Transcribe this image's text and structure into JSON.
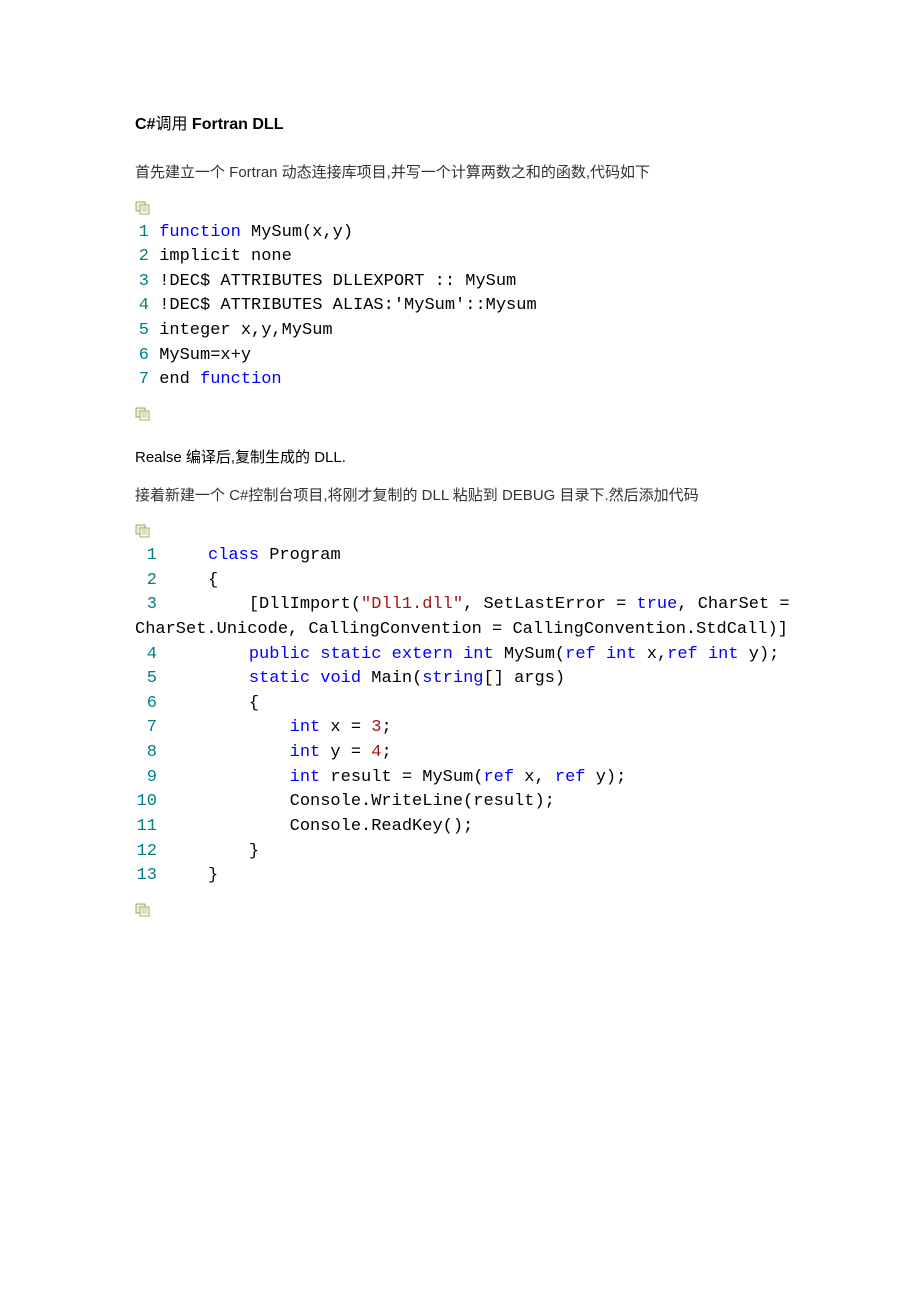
{
  "title_prefix": "C#",
  "title_cn": "调用",
  "title_bold": " Fortran DLL",
  "para1": "首先建立一个 Fortran 动态连接库项目,并写一个计算两数之和的函数,代码如下",
  "fortran_code": {
    "lines": [
      {
        "n": "1",
        "tokens": [
          {
            "t": " ",
            "c": "plain"
          },
          {
            "t": "function",
            "c": "kw-blue"
          },
          {
            "t": " MySum(x,y)",
            "c": "plain"
          }
        ]
      },
      {
        "n": "2",
        "tokens": [
          {
            "t": " implicit none",
            "c": "plain"
          }
        ]
      },
      {
        "n": "3",
        "tokens": [
          {
            "t": " !DEC$ ATTRIBUTES DLLEXPORT :: MySum",
            "c": "plain"
          }
        ]
      },
      {
        "n": "4",
        "tokens": [
          {
            "t": " !DEC$ ATTRIBUTES ALIAS:'MySum'::Mysum",
            "c": "plain"
          }
        ]
      },
      {
        "n": "5",
        "tokens": [
          {
            "t": " integer x,y,MySum",
            "c": "plain"
          }
        ]
      },
      {
        "n": "6",
        "tokens": [
          {
            "t": " MySum=x+y",
            "c": "plain"
          }
        ]
      },
      {
        "n": "7",
        "tokens": [
          {
            "t": " end ",
            "c": "plain"
          },
          {
            "t": "function",
            "c": "kw-blue"
          }
        ]
      }
    ]
  },
  "para2": "Realse 编译后,复制生成的 DLL.",
  "para3": "接着新建一个 C#控制台项目,将刚才复制的 DLL 粘贴到 DEBUG 目录下.然后添加代码",
  "csharp_code": {
    "lines": [
      {
        "n": " 1",
        "tokens": [
          {
            "t": "     ",
            "c": "plain"
          },
          {
            "t": "class",
            "c": "kw-blue"
          },
          {
            "t": " Program",
            "c": "plain"
          }
        ]
      },
      {
        "n": " 2",
        "tokens": [
          {
            "t": "     {",
            "c": "plain"
          }
        ]
      },
      {
        "n": " 3",
        "tokens": [
          {
            "t": "         [DllImport(",
            "c": "plain"
          },
          {
            "t": "\"Dll1.dll\"",
            "c": "str-red"
          },
          {
            "t": ", SetLastError = ",
            "c": "plain"
          },
          {
            "t": "true",
            "c": "kw-blue"
          },
          {
            "t": ", CharSet = ",
            "c": "plain"
          }
        ]
      },
      {
        "n": "",
        "wrap": true,
        "tokens": [
          {
            "t": "CharSet.Unicode, CallingConvention = CallingConvention.StdCall)]",
            "c": "plain"
          }
        ]
      },
      {
        "n": " 4",
        "tokens": [
          {
            "t": "         ",
            "c": "plain"
          },
          {
            "t": "public",
            "c": "kw-blue"
          },
          {
            "t": " ",
            "c": "plain"
          },
          {
            "t": "static",
            "c": "kw-blue"
          },
          {
            "t": " ",
            "c": "plain"
          },
          {
            "t": "extern",
            "c": "kw-blue"
          },
          {
            "t": " ",
            "c": "plain"
          },
          {
            "t": "int",
            "c": "kw-blue"
          },
          {
            "t": " MySum(",
            "c": "plain"
          },
          {
            "t": "ref",
            "c": "kw-blue"
          },
          {
            "t": " ",
            "c": "plain"
          },
          {
            "t": "int",
            "c": "kw-blue"
          },
          {
            "t": " x,",
            "c": "plain"
          },
          {
            "t": "ref",
            "c": "kw-blue"
          },
          {
            "t": " ",
            "c": "plain"
          },
          {
            "t": "int",
            "c": "kw-blue"
          },
          {
            "t": " y);",
            "c": "plain"
          }
        ]
      },
      {
        "n": " 5",
        "tokens": [
          {
            "t": "         ",
            "c": "plain"
          },
          {
            "t": "static",
            "c": "kw-blue"
          },
          {
            "t": " ",
            "c": "plain"
          },
          {
            "t": "void",
            "c": "kw-blue"
          },
          {
            "t": " Main(",
            "c": "plain"
          },
          {
            "t": "string",
            "c": "kw-blue"
          },
          {
            "t": "[] args)",
            "c": "plain"
          }
        ]
      },
      {
        "n": " 6",
        "tokens": [
          {
            "t": "         {",
            "c": "plain"
          }
        ]
      },
      {
        "n": " 7",
        "tokens": [
          {
            "t": "             ",
            "c": "plain"
          },
          {
            "t": "int",
            "c": "kw-blue"
          },
          {
            "t": " x = ",
            "c": "plain"
          },
          {
            "t": "3",
            "c": "str-red"
          },
          {
            "t": ";",
            "c": "plain"
          }
        ]
      },
      {
        "n": " 8",
        "tokens": [
          {
            "t": "             ",
            "c": "plain"
          },
          {
            "t": "int",
            "c": "kw-blue"
          },
          {
            "t": " y = ",
            "c": "plain"
          },
          {
            "t": "4",
            "c": "str-red"
          },
          {
            "t": ";",
            "c": "plain"
          }
        ]
      },
      {
        "n": " 9",
        "tokens": [
          {
            "t": "             ",
            "c": "plain"
          },
          {
            "t": "int",
            "c": "kw-blue"
          },
          {
            "t": " result = MySum(",
            "c": "plain"
          },
          {
            "t": "ref",
            "c": "kw-blue"
          },
          {
            "t": " x, ",
            "c": "plain"
          },
          {
            "t": "ref",
            "c": "kw-blue"
          },
          {
            "t": " y);",
            "c": "plain"
          }
        ]
      },
      {
        "n": "10",
        "tokens": [
          {
            "t": "             Console.WriteLine(result);",
            "c": "plain"
          }
        ]
      },
      {
        "n": "11",
        "tokens": [
          {
            "t": "             Console.ReadKey();",
            "c": "plain"
          }
        ]
      },
      {
        "n": "12",
        "tokens": [
          {
            "t": "         }",
            "c": "plain"
          }
        ]
      },
      {
        "n": "13",
        "tokens": [
          {
            "t": "     }",
            "c": "plain"
          }
        ]
      }
    ]
  }
}
